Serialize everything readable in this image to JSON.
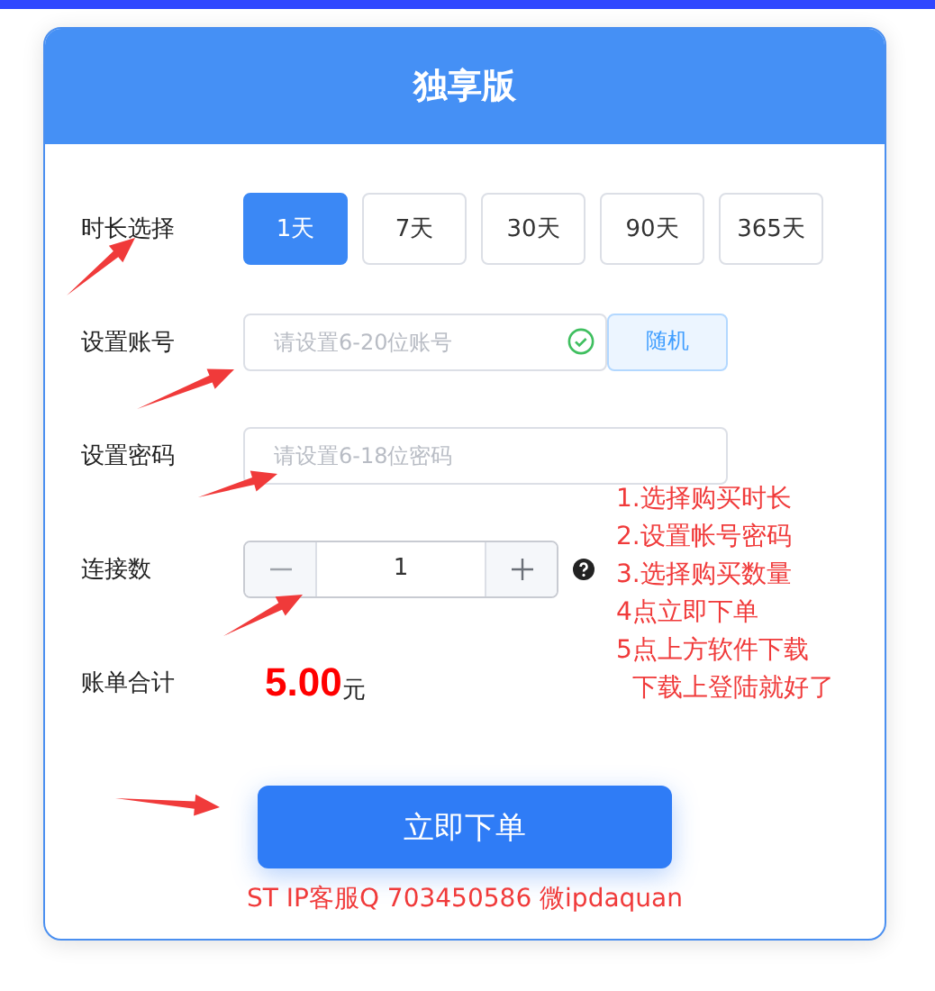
{
  "title": "独享版",
  "duration": {
    "label": "时长选择",
    "options": [
      {
        "label": "1天",
        "selected": true
      },
      {
        "label": "7天",
        "selected": false
      },
      {
        "label": "30天",
        "selected": false
      },
      {
        "label": "90天",
        "selected": false
      },
      {
        "label": "365天",
        "selected": false
      }
    ]
  },
  "account": {
    "label": "设置账号",
    "placeholder": "请设置6-20位账号",
    "random_button": "随机"
  },
  "password": {
    "label": "设置密码",
    "placeholder": "请设置6-18位密码"
  },
  "connections": {
    "label": "连接数",
    "value": "1"
  },
  "total": {
    "label": "账单合计",
    "amount": "5.00",
    "unit": "元"
  },
  "instructions": [
    "1.选择购买时长",
    "2.设置帐号密码",
    "3.选择购买数量",
    "4点立即下单",
    "5点上方软件下载",
    "  下载上登陆就好了"
  ],
  "order_button": "立即下单",
  "contact": "ST IP客服Q 703450586 微ipdaquan"
}
